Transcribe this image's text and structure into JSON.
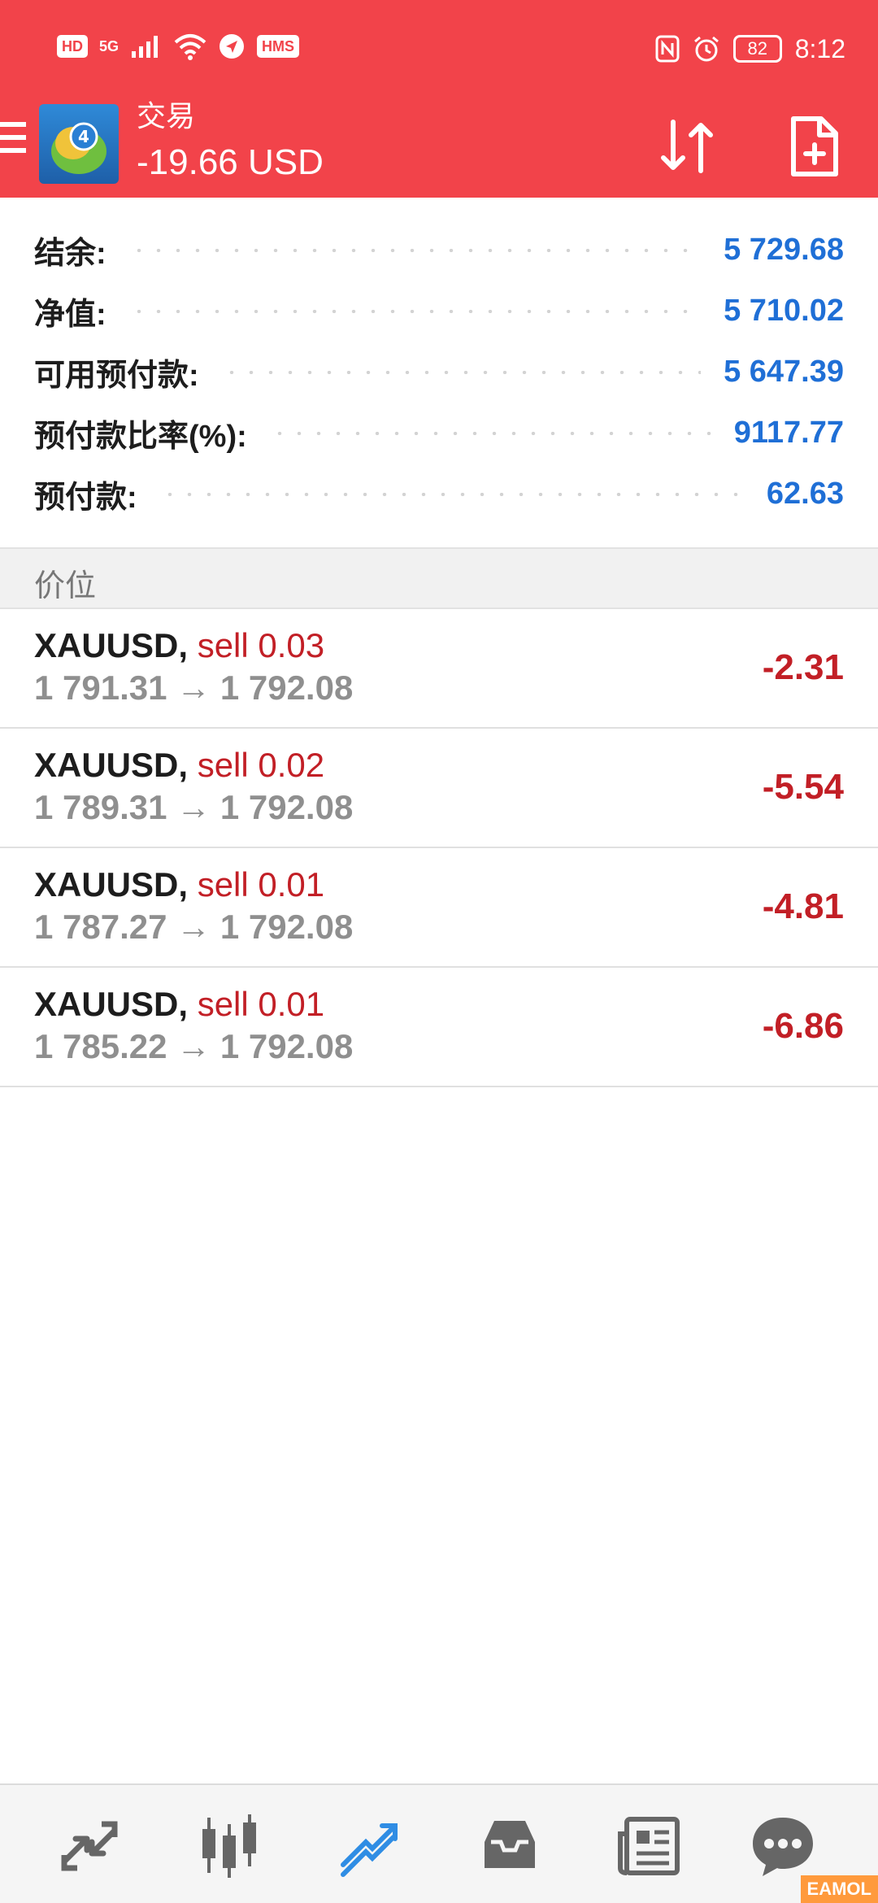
{
  "status_bar": {
    "left_badges": [
      "HD",
      "5G",
      "HMS"
    ],
    "battery": "82",
    "time": "8:12"
  },
  "header": {
    "title": "交易",
    "profit": "-19.66 USD",
    "icons": [
      "menu-icon",
      "mt4-logo",
      "sort-icon",
      "new-order-icon"
    ]
  },
  "summary": [
    {
      "label": "结余:",
      "value": "5 729.68"
    },
    {
      "label": "净值:",
      "value": "5 710.02"
    },
    {
      "label": "可用预付款:",
      "value": "5 647.39"
    },
    {
      "label": "预付款比率(%):",
      "value": "9117.77"
    },
    {
      "label": "预付款:",
      "value": "62.63"
    }
  ],
  "section_title": "价位",
  "positions": [
    {
      "symbol": "XAUUSD,",
      "action": "sell 0.03",
      "prices": "1 791.31 → 1 792.08",
      "profit": "-2.31"
    },
    {
      "symbol": "XAUUSD,",
      "action": "sell 0.02",
      "prices": "1 789.31 → 1 792.08",
      "profit": "-5.54"
    },
    {
      "symbol": "XAUUSD,",
      "action": "sell 0.01",
      "prices": "1 787.27 → 1 792.08",
      "profit": "-4.81"
    },
    {
      "symbol": "XAUUSD,",
      "action": "sell 0.01",
      "prices": "1 785.22 → 1 792.08",
      "profit": "-6.86"
    }
  ],
  "bottom_nav": [
    "quotes-icon",
    "chart-icon",
    "trade-icon",
    "history-icon",
    "news-icon",
    "chat-icon"
  ],
  "watermark": "EAMOL",
  "colors": {
    "accent": "#f2434a",
    "value_blue": "#1f6fd6",
    "loss_red": "#c21f26",
    "active_nav": "#2f8de4"
  }
}
